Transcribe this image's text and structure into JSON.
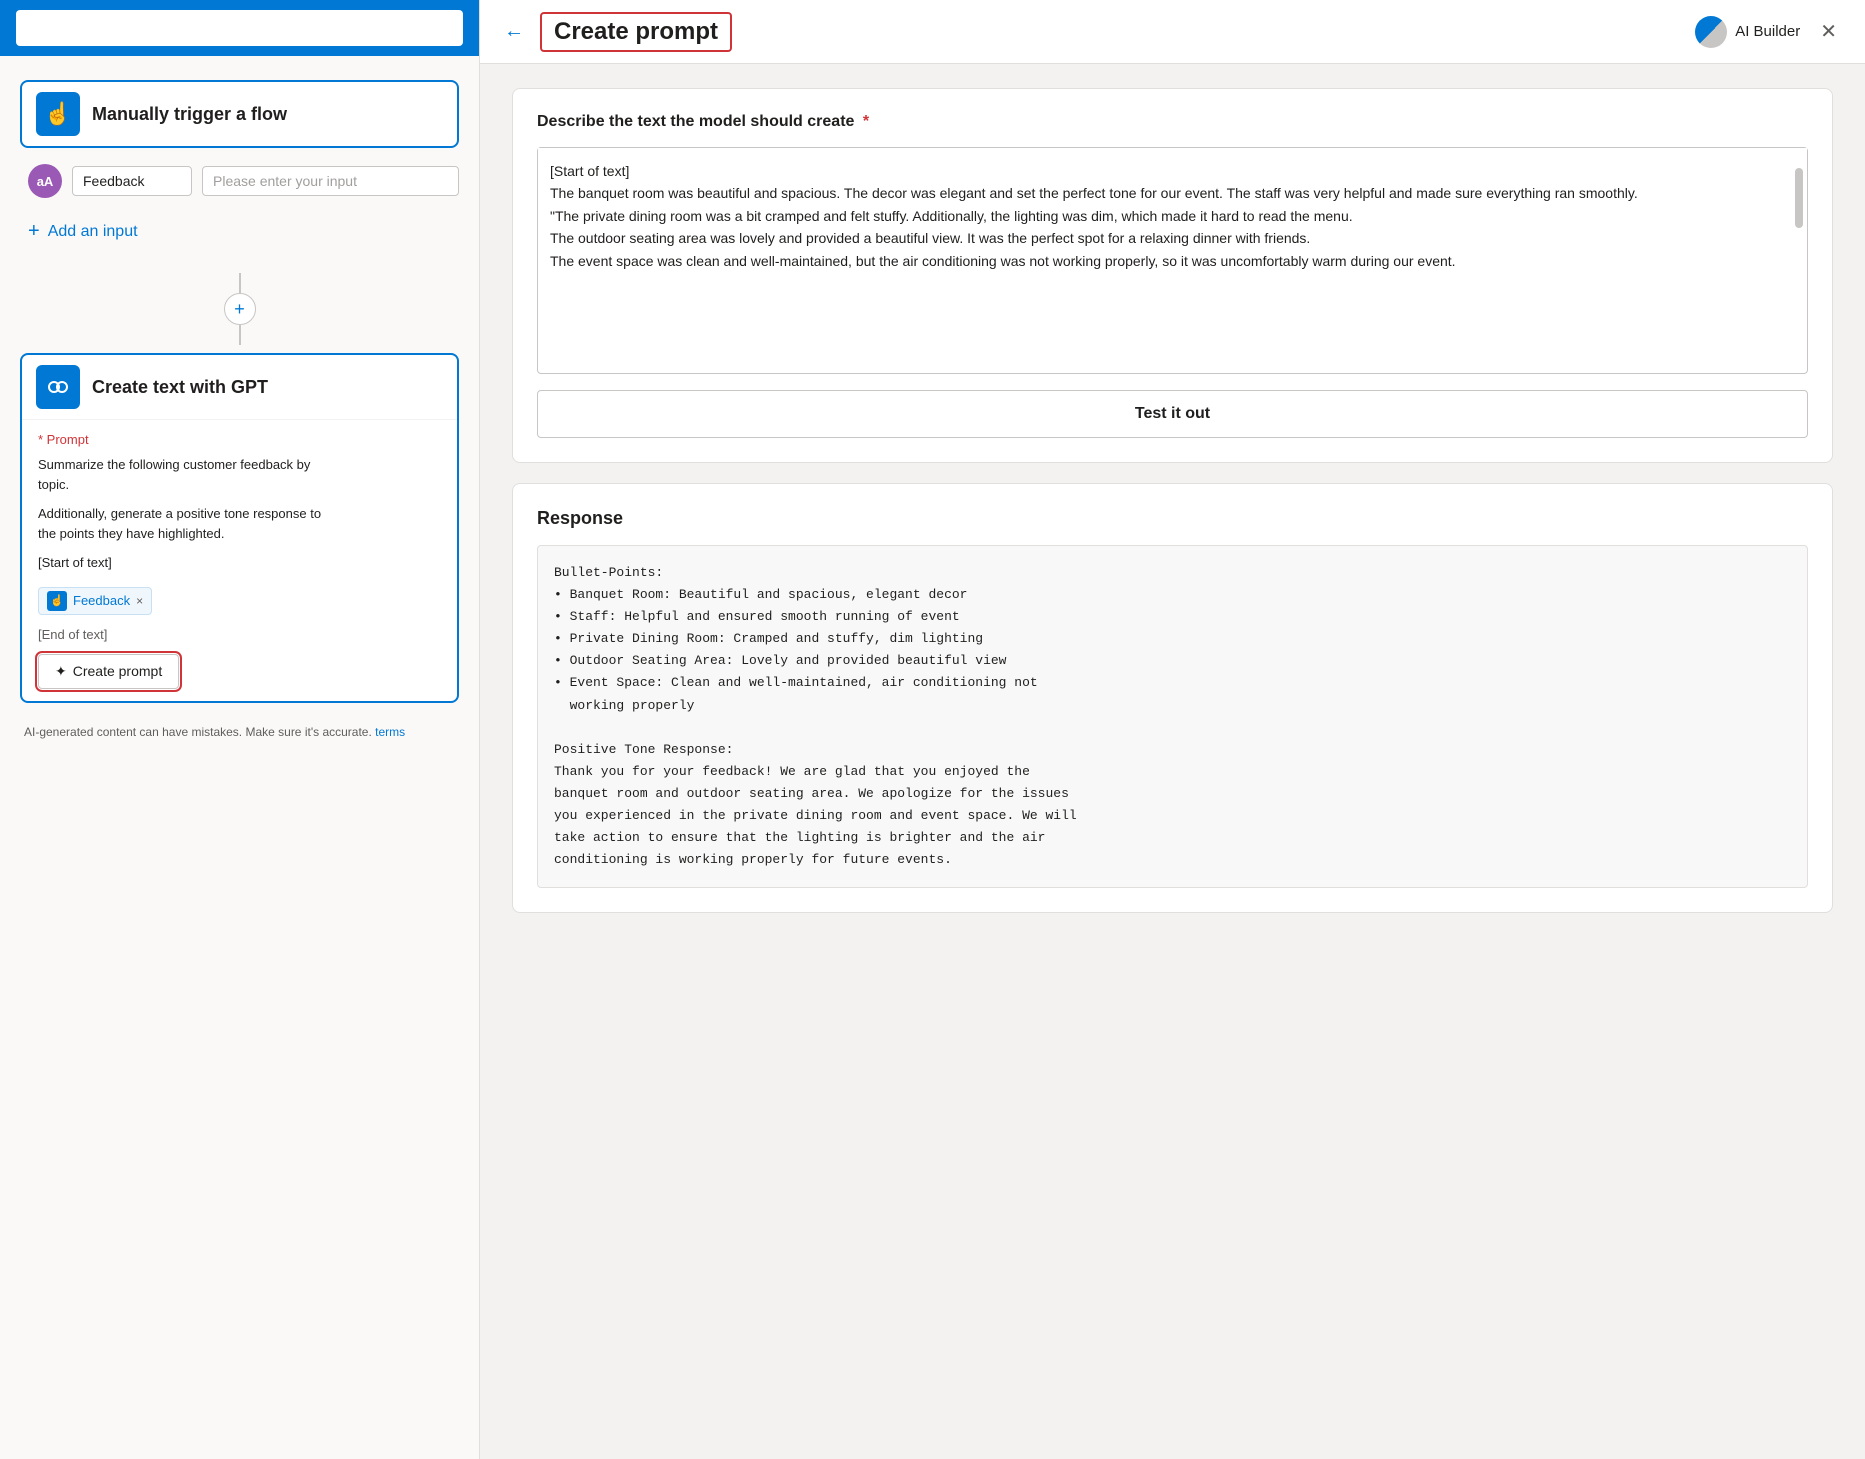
{
  "left": {
    "trigger": {
      "label": "Manually trigger a flow",
      "icon": "☝"
    },
    "input_row": {
      "avatar": "aA",
      "field_value": "Feedback",
      "placeholder": "Please enter your input"
    },
    "add_input_label": "Add an input",
    "gpt": {
      "label": "Create text with GPT",
      "icon": "🤖",
      "prompt_label": "* Prompt",
      "prompt_lines": [
        "Summarize the following customer feedback by topic.",
        "Additionally, generate a positive tone response to the points they have highlighted.",
        "",
        "[Start of text]"
      ],
      "feedback_tag_label": "Feedback",
      "end_text": "[End of text]"
    },
    "create_prompt_btn": "Create prompt",
    "disclaimer": "AI-generated content can have mistakes. Make sure it's accurate.",
    "terms_link": "terms"
  },
  "right": {
    "header": {
      "title": "Create prompt",
      "ai_builder_label": "AI Builder"
    },
    "describe_section": {
      "title": "Describe the text the model should create",
      "textarea_value": "[Start of text]\nThe banquet room was beautiful and spacious. The decor was elegant and set the perfect tone for our event. The staff was very helpful and made sure everything ran smoothly.\n\"The private dining room was a bit cramped and felt stuffy. Additionally, the lighting was dim, which made it hard to read the menu.\nThe outdoor seating area was lovely and provided a beautiful view. It was the perfect spot for a relaxing dinner with friends.\nThe event space was clean and well-maintained, but the air conditioning was not working properly, so it was uncomfortably warm during our event."
    },
    "test_btn_label": "Test it out",
    "response": {
      "title": "Response",
      "content": "Bullet-Points:\n• Banquet Room: Beautiful and spacious, elegant decor\n• Staff: Helpful and ensured smooth running of event\n• Private Dining Room: Cramped and stuffy, dim lighting\n• Outdoor Seating Area: Lovely and provided beautiful view\n• Event Space: Clean and well-maintained, air conditioning not\n  working properly\n\nPositive Tone Response:\nThank you for your feedback! We are glad that you enjoyed the\nbanquet room and outdoor seating area. We apologize for the issues\nyou experienced in the private dining room and event space. We will\ntake action to ensure that the lighting is brighter and the air\nconditioning is working properly for future events."
    }
  }
}
